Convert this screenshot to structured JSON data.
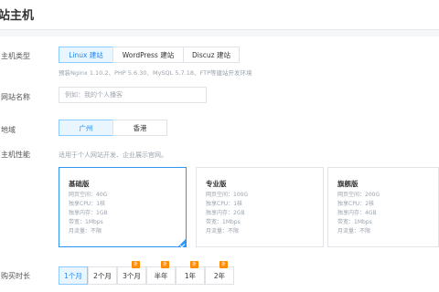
{
  "page": {
    "title": "站主机"
  },
  "host_type": {
    "label": "主机类型",
    "options": [
      "Linux 建站",
      "WordPress 建站",
      "Discuz 建站"
    ],
    "selected_index": 0,
    "hint": "预装Nginx 1.10.2、PHP 5.6.30、MySQL 5.7.18、FTP等建站开发环境"
  },
  "site_name": {
    "label": "网站名称",
    "placeholder": "例如：我的个人播客"
  },
  "region": {
    "label": "地域",
    "options": [
      "广州",
      "香港"
    ],
    "selected_index": 0
  },
  "performance": {
    "label": "主机性能",
    "hint": "适用于个人网站开发、企业展示官网。",
    "cards": [
      {
        "name": "基础版",
        "specs": [
          "网页空间：40G",
          "独享CPU：1核",
          "独享内存：1GB",
          "带宽：1Mbps",
          "月流量：不限"
        ],
        "selected": true
      },
      {
        "name": "专业版",
        "specs": [
          "网页空间：100G",
          "独享CPU：1核",
          "独享内存：2GB",
          "带宽：1Mbps",
          "月流量：不限"
        ],
        "selected": false
      },
      {
        "name": "旗舰版",
        "specs": [
          "网页空间：200G",
          "独享CPU：2核",
          "独享内存：4GB",
          "带宽：1Mbps",
          "月流量：不限"
        ],
        "selected": false
      }
    ]
  },
  "duration": {
    "label": "购买时长",
    "options": [
      {
        "text": "1个月",
        "badge": ""
      },
      {
        "text": "2个月",
        "badge": ""
      },
      {
        "text": "3个月",
        "badge": "折"
      },
      {
        "text": "半年",
        "badge": "折"
      },
      {
        "text": "1年",
        "badge": "折"
      },
      {
        "text": "2年",
        "badge": "折"
      }
    ],
    "selected_index": 0
  },
  "colors": {
    "accent": "#2f95f2",
    "active_bg": "#eaf6ff",
    "badge": "#ff8a00"
  }
}
